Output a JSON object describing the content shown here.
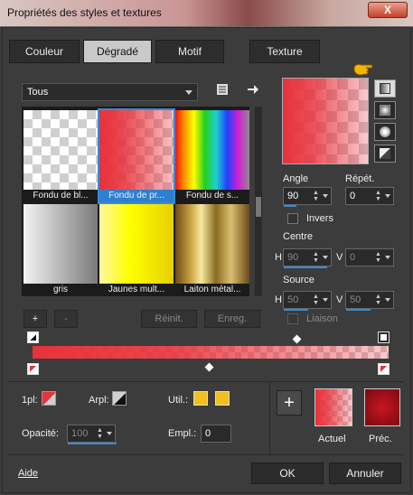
{
  "window": {
    "title": "Propriétés des styles et textures",
    "close_label": "X"
  },
  "tabs": [
    {
      "label": "Couleur",
      "active": false
    },
    {
      "label": "Dégradé",
      "active": true
    },
    {
      "label": "Motif",
      "active": false
    },
    {
      "label": "Texture",
      "active": false
    }
  ],
  "category_select": {
    "value": "Tous"
  },
  "gallery": {
    "items": [
      {
        "label": "Fondu de bl..."
      },
      {
        "label": "Fondu de pr...",
        "selected": true
      },
      {
        "label": "Fondu de s..."
      },
      {
        "label": "gris"
      },
      {
        "label": "Jaunes mult..."
      },
      {
        "label": "Laiton métal..."
      }
    ]
  },
  "gallery_buttons": {
    "add": "+",
    "remove": "-",
    "reset": "Réinit.",
    "save": "Enreg."
  },
  "angle": {
    "label": "Angle",
    "value": "90"
  },
  "repeat": {
    "label": "Répét.",
    "value": "0"
  },
  "invert": {
    "label": "Invers"
  },
  "center": {
    "label": "Centre",
    "h_label": "H",
    "h_value": "90",
    "v_label": "V",
    "v_value": "0"
  },
  "source": {
    "label": "Source",
    "h_label": "H",
    "h_value": "50",
    "v_label": "V",
    "v_value": "50"
  },
  "link": {
    "label": "Liaison"
  },
  "bottom": {
    "first_plane_label": "1pl:",
    "back_plane_label": "Arpl:",
    "use_label": "Util.:",
    "opacity_label": "Opacité:",
    "opacity_value": "100",
    "location_label": "Empl.:",
    "location_value": "0",
    "current_label": "Actuel",
    "previous_label": "Préc.",
    "add_label": "+"
  },
  "footer": {
    "help": "Aide",
    "ok": "OK",
    "cancel": "Annuler"
  },
  "colors": {
    "accent": "#3a8ad8",
    "red": "#e8323c",
    "dark_red": "#a8101a",
    "yellow": "#f0d020"
  }
}
